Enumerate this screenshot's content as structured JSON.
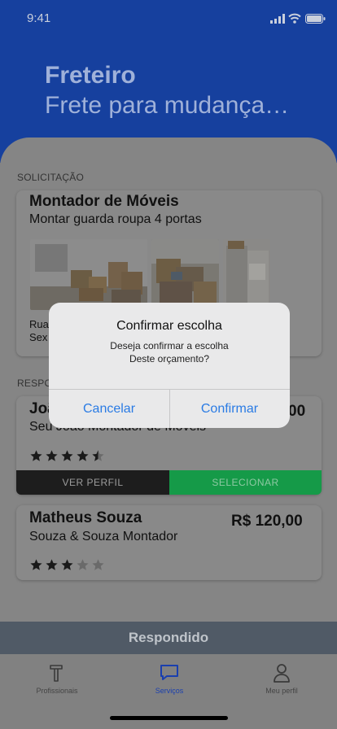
{
  "status_bar": {
    "time": "9:41"
  },
  "header": {
    "title": "Freteiro",
    "subtitle": "Frete para mudança…"
  },
  "request": {
    "section_label": "SOLICITAÇÃO",
    "title": "Montador de Móveis",
    "subtitle": "Montar guarda roupa 4 portas",
    "address_line1": "Rua",
    "address_line2": "Sex"
  },
  "responses": {
    "section_label": "RESPO",
    "items": [
      {
        "name": "Joã",
        "company": "Seu João Montador de Móveis",
        "price": "00",
        "rating": 4.5,
        "view_profile_label": "VER PERFIL",
        "select_label": "SELECIONAR"
      },
      {
        "name": "Matheus Souza",
        "company": "Souza & Souza Montador",
        "price": "R$ 120,00",
        "rating": 3
      }
    ]
  },
  "dialog": {
    "title": "Confirmar escolha",
    "message_line1": "Deseja confirmar a escolha",
    "message_line2": "Deste orçamento?",
    "cancel_label": "Cancelar",
    "confirm_label": "Confirmar"
  },
  "bottom_bar": {
    "responded_label": "Respondido"
  },
  "tabs": [
    {
      "label": "Profissionais",
      "icon": "hammer-icon",
      "active": false
    },
    {
      "label": "Serviços",
      "icon": "chat-icon",
      "active": true
    },
    {
      "label": "Meu perfil",
      "icon": "user-icon",
      "active": false
    }
  ],
  "colors": {
    "header_blue": "#16409e",
    "select_green": "#159a48",
    "dialog_button_blue": "#2a7be4",
    "active_tab": "#1a3fae"
  }
}
